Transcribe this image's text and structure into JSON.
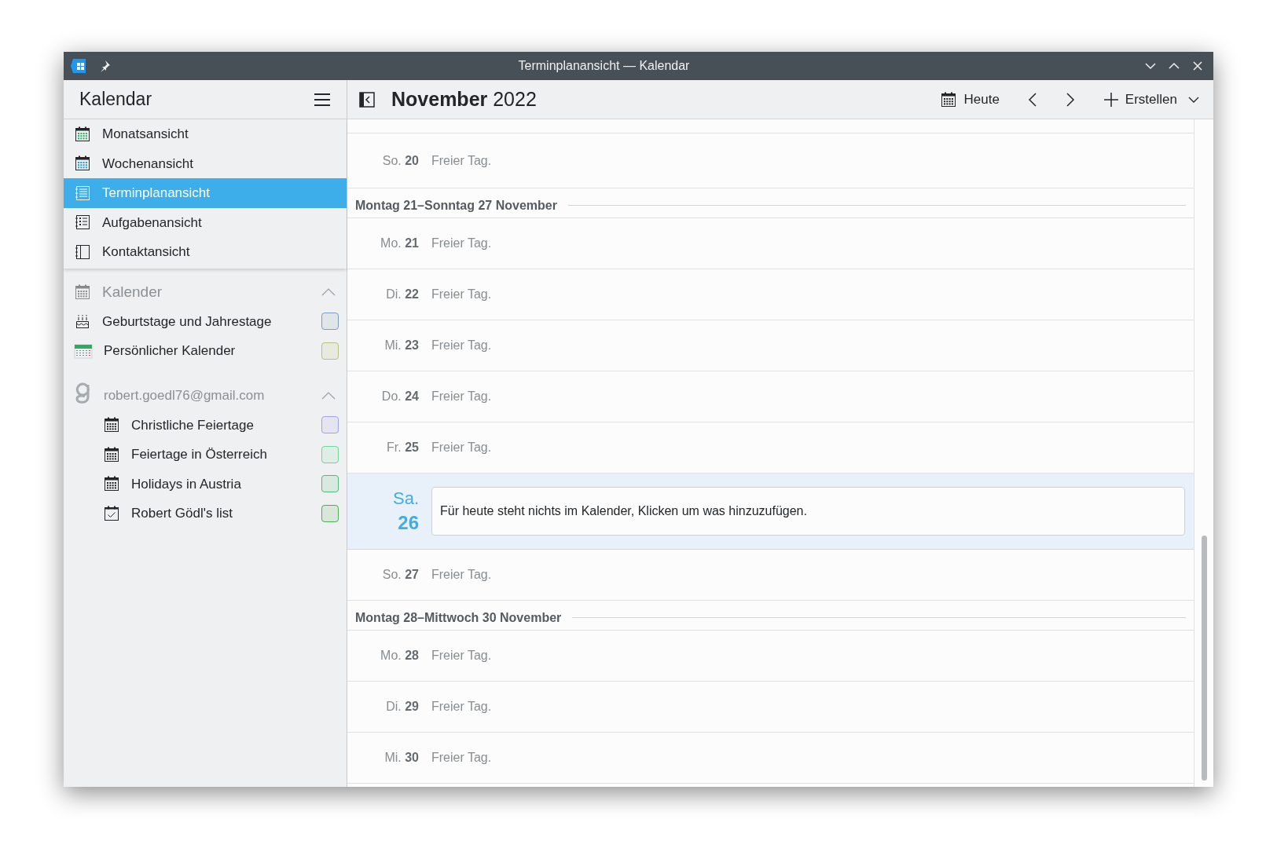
{
  "window": {
    "title": "Terminplanansicht — Kalendar"
  },
  "sidebar": {
    "title": "Kalendar",
    "views": [
      {
        "label": "Monatsansicht",
        "selected": false
      },
      {
        "label": "Wochenansicht",
        "selected": false
      },
      {
        "label": "Terminplanansicht",
        "selected": true
      },
      {
        "label": "Aufgabenansicht",
        "selected": false
      },
      {
        "label": "Kontaktansicht",
        "selected": false
      }
    ],
    "sections": [
      {
        "kind": "local",
        "title": "Kalender",
        "expanded": true,
        "calendars": [
          {
            "label": "Geburtstage und Jahrestage",
            "color": "#7f9bc4",
            "checked": false
          },
          {
            "label": "Persönlicher Kalender",
            "color": "#b8c27a",
            "checked": false
          }
        ]
      },
      {
        "kind": "google",
        "title": "robert.goedl76@gmail.com",
        "expanded": true,
        "calendars": [
          {
            "label": "Christliche Feiertage",
            "color": "#9f9ff5",
            "checked": false
          },
          {
            "label": "Feiertage in Österreich",
            "color": "#6fd79a",
            "checked": false
          },
          {
            "label": "Holidays in Austria",
            "color": "#4cbf7a",
            "checked": false
          },
          {
            "label": "Robert Gödl's list",
            "color": "#4caf50",
            "checked": false
          }
        ]
      }
    ]
  },
  "toolbar": {
    "month": "November",
    "year": "2022",
    "today": "Heute",
    "create": "Erstellen"
  },
  "agenda": [
    {
      "kind": "day",
      "weekday": "So.",
      "day": "20",
      "text": "Freier Tag."
    },
    {
      "kind": "week_header",
      "text": "Montag 21–Sonntag 27 November"
    },
    {
      "kind": "day",
      "weekday": "Mo.",
      "day": "21",
      "text": "Freier Tag."
    },
    {
      "kind": "day",
      "weekday": "Di.",
      "day": "22",
      "text": "Freier Tag."
    },
    {
      "kind": "day",
      "weekday": "Mi.",
      "day": "23",
      "text": "Freier Tag."
    },
    {
      "kind": "day",
      "weekday": "Do.",
      "day": "24",
      "text": "Freier Tag."
    },
    {
      "kind": "day",
      "weekday": "Fr.",
      "day": "25",
      "text": "Freier Tag."
    },
    {
      "kind": "today",
      "weekday": "Sa.",
      "day": "26",
      "text": "Für heute steht nichts im Kalender, Klicken um was hinzuzufügen."
    },
    {
      "kind": "day",
      "weekday": "So.",
      "day": "27",
      "text": "Freier Tag."
    },
    {
      "kind": "week_header",
      "text": "Montag 28–Mittwoch 30 November"
    },
    {
      "kind": "day",
      "weekday": "Mo.",
      "day": "28",
      "text": "Freier Tag."
    },
    {
      "kind": "day",
      "weekday": "Di.",
      "day": "29",
      "text": "Freier Tag."
    },
    {
      "kind": "day",
      "weekday": "Mi.",
      "day": "30",
      "text": "Freier Tag."
    }
  ]
}
